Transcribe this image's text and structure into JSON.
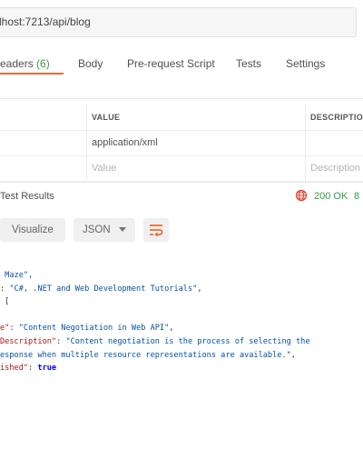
{
  "request": {
    "url": "lhost:7213/api/blog"
  },
  "tabs": [
    {
      "label": "eaders",
      "count": "(6)",
      "active": true
    },
    {
      "label": "Body"
    },
    {
      "label": "Pre-request Script"
    },
    {
      "label": "Tests"
    },
    {
      "label": "Settings"
    }
  ],
  "headers_table": {
    "columns": [
      "VALUE",
      "DESCRIPTION"
    ],
    "rows": [
      {
        "value": "application/xml",
        "description": ""
      }
    ],
    "new_row": {
      "value_placeholder": "Value",
      "description_placeholder": "Description"
    }
  },
  "response": {
    "tab_label": "Test Results",
    "status": "200 OK",
    "status_extra": "8",
    "status_color": "#2f9e44"
  },
  "view_controls": {
    "visualize": "Visualize",
    "format": "JSON",
    "accent": "#f26b3a"
  },
  "body_lines": {
    "l1": {
      "s": " Maze\","
    },
    "l2": {
      "p": ": ",
      "s": "\"C#, .NET and Web Development Tutorials\"",
      "p2": ","
    },
    "l3": {
      "p": "["
    },
    "l4": {
      "k": "e\"",
      "p": ": ",
      "s": "\"Content Negotiation in Web API\"",
      "p2": ","
    },
    "l5": {
      "k": "Description\"",
      "p": ": ",
      "s": "\"Content negotiation is the process of selecting the"
    },
    "l6": {
      "s": "esponse when multiple resource representations are available.\"",
      "p": ","
    },
    "l7": {
      "k": "ished\"",
      "p": ": ",
      "b": "true"
    }
  }
}
